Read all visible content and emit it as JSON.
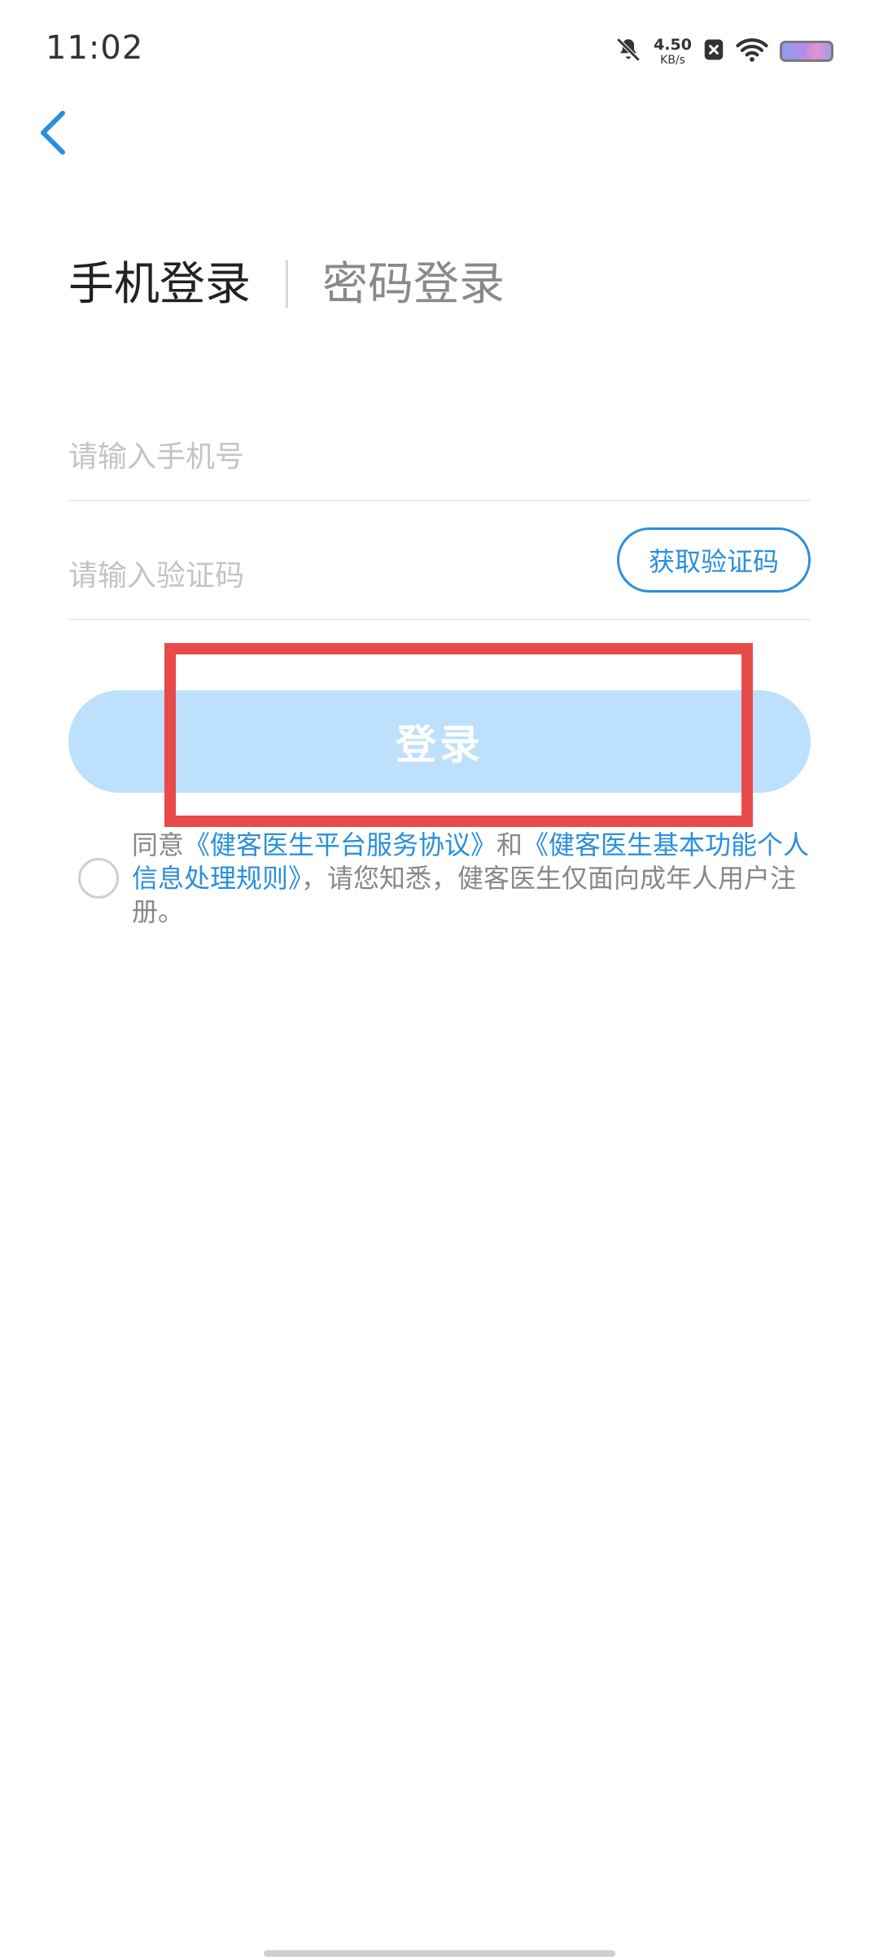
{
  "status_bar": {
    "time": "11:02",
    "net_speed_value": "4.50",
    "net_speed_unit": "KB/s",
    "icons": [
      "bell-muted-icon",
      "notification-x-icon",
      "wifi-icon",
      "battery-icon"
    ]
  },
  "nav": {
    "back_icon": "chevron-left-icon"
  },
  "tabs": {
    "phone_login": "手机登录",
    "password_login": "密码登录"
  },
  "form": {
    "phone_placeholder": "请输入手机号",
    "code_placeholder": "请输入验证码",
    "get_code_label": "获取验证码",
    "login_label": "登录"
  },
  "agreement": {
    "prefix": "同意",
    "link1": "《健客医生平台服务协议》",
    "conj": "和",
    "link2": "《健客医生基本功能个人信息处理规则》",
    "suffix": "，请您知悉，健客医生仅面向成年人用户注册。"
  },
  "colors": {
    "accent": "#2a8fdc",
    "login_button_disabled": "#bde0fd",
    "highlight": "#e84a4a"
  }
}
